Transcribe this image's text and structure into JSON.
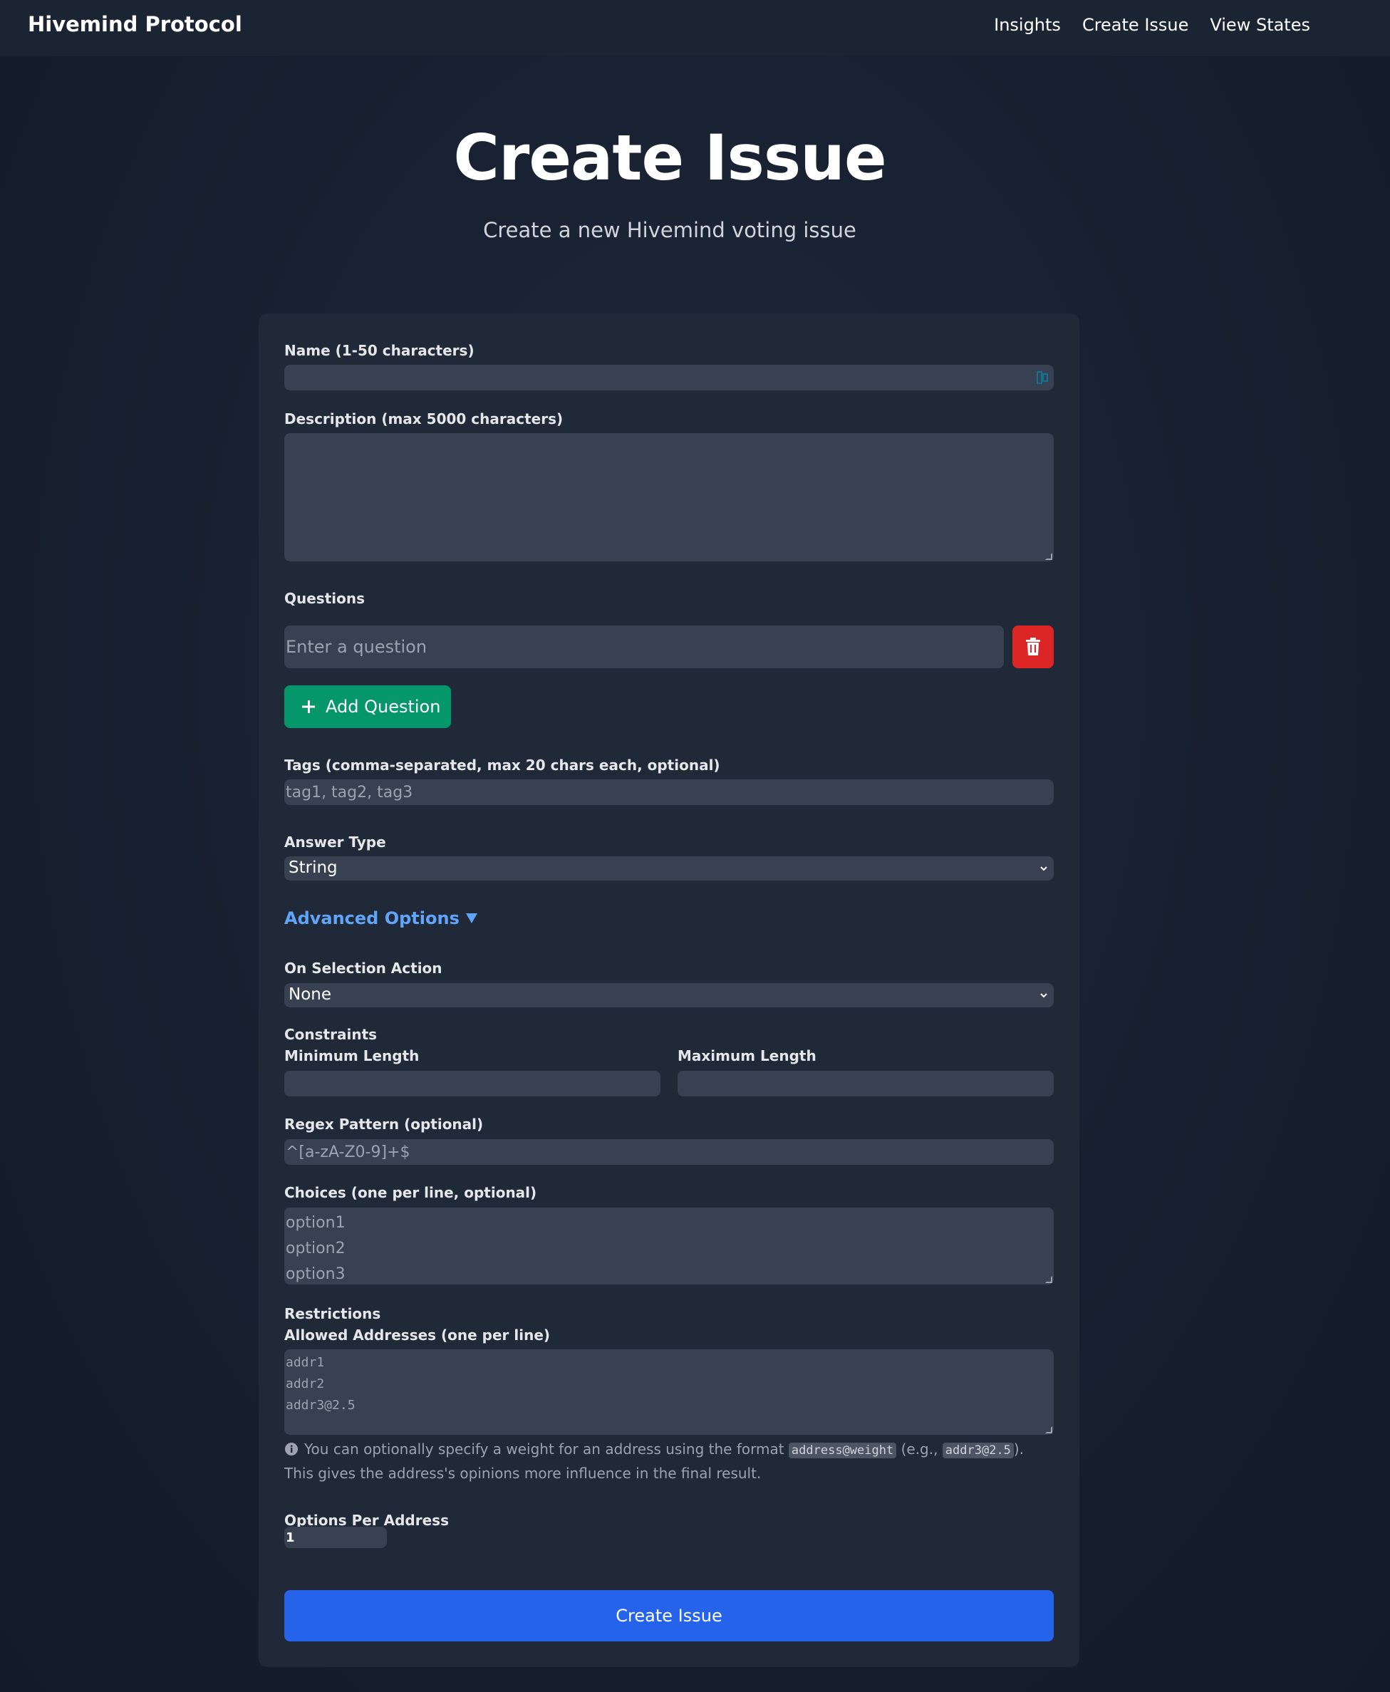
{
  "nav": {
    "brand": "Hivemind Protocol",
    "links": [
      "Insights",
      "Create Issue",
      "View States"
    ]
  },
  "header": {
    "title": "Create Issue",
    "subtitle": "Create a new Hivemind voting issue"
  },
  "form": {
    "name_label": "Name (1-50 characters)",
    "name_value": "",
    "description_label": "Description (max 5000 characters)",
    "description_value": "",
    "questions_label": "Questions",
    "question_placeholder": "Enter a question",
    "add_question_label": "Add Question",
    "tags_label": "Tags (comma-separated, max 20 chars each, optional)",
    "tags_placeholder": "tag1, tag2, tag3",
    "answer_type_label": "Answer Type",
    "answer_type_value": "String",
    "advanced_label": "Advanced Options",
    "on_selection_label": "On Selection Action",
    "on_selection_value": "None",
    "constraints_label": "Constraints",
    "min_length_label": "Minimum Length",
    "max_length_label": "Maximum Length",
    "regex_label": "Regex Pattern (optional)",
    "regex_placeholder": "^[a-zA-Z0-9]+$",
    "choices_label": "Choices (one per line, optional)",
    "choices_placeholder": [
      "option1",
      "option2",
      "option3"
    ],
    "restrictions_label": "Restrictions",
    "allowed_addresses_label": "Allowed Addresses (one per line)",
    "allowed_addresses_placeholder": [
      "addr1",
      "addr2",
      "addr3@2.5"
    ],
    "hint_prefix": "You can optionally specify a weight for an address using the format",
    "hint_code_1": "address@weight",
    "hint_mid": "(e.g.,",
    "hint_code_2": "addr3@2.5",
    "hint_suffix": "). This gives the address's opinions more influence in the final result.",
    "options_per_address_label": "Options Per Address",
    "options_per_address_value": "1",
    "submit_label": "Create Issue"
  },
  "colors": {
    "background": "#172030",
    "card": "#1f2937",
    "field": "#374151",
    "accent_blue": "#2563eb",
    "link_blue": "#60a5fa",
    "add_green": "#059669",
    "delete_red": "#dc2626"
  }
}
